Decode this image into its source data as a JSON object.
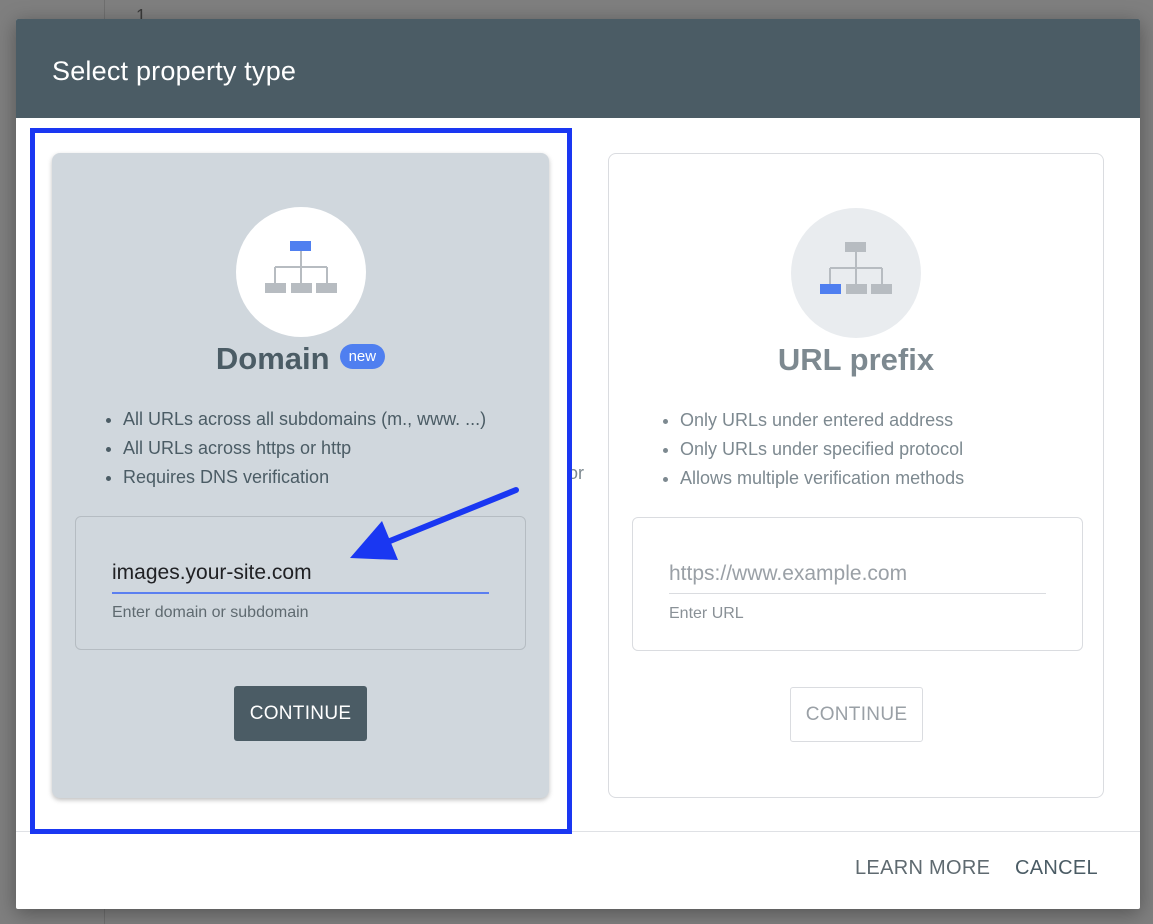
{
  "background": {
    "number": "1"
  },
  "dialog": {
    "title": "Select property type",
    "header_color": "#4b5c65"
  },
  "domain_card": {
    "icon": "sitemap-icon",
    "title": "Domain",
    "badge": "new",
    "bullets": [
      "All URLs across all subdomains (m., www. ...)",
      "All URLs across https or http",
      "Requires DNS verification"
    ],
    "input": {
      "value": "images.your-site.com",
      "hint": "Enter domain or subdomain"
    },
    "button_label": "CONTINUE"
  },
  "separator": "or",
  "url_card": {
    "icon": "sitemap-icon",
    "title": "URL prefix",
    "bullets": [
      "Only URLs under entered address",
      "Only URLs under specified protocol",
      "Allows multiple verification methods"
    ],
    "input": {
      "placeholder": "https://www.example.com",
      "hint": "Enter URL"
    },
    "button_label": "CONTINUE"
  },
  "footer": {
    "learn_more": "LEARN MORE",
    "cancel": "CANCEL"
  },
  "annotation": {
    "highlight_color": "#1a37f2",
    "arrow": "arrow-icon"
  }
}
